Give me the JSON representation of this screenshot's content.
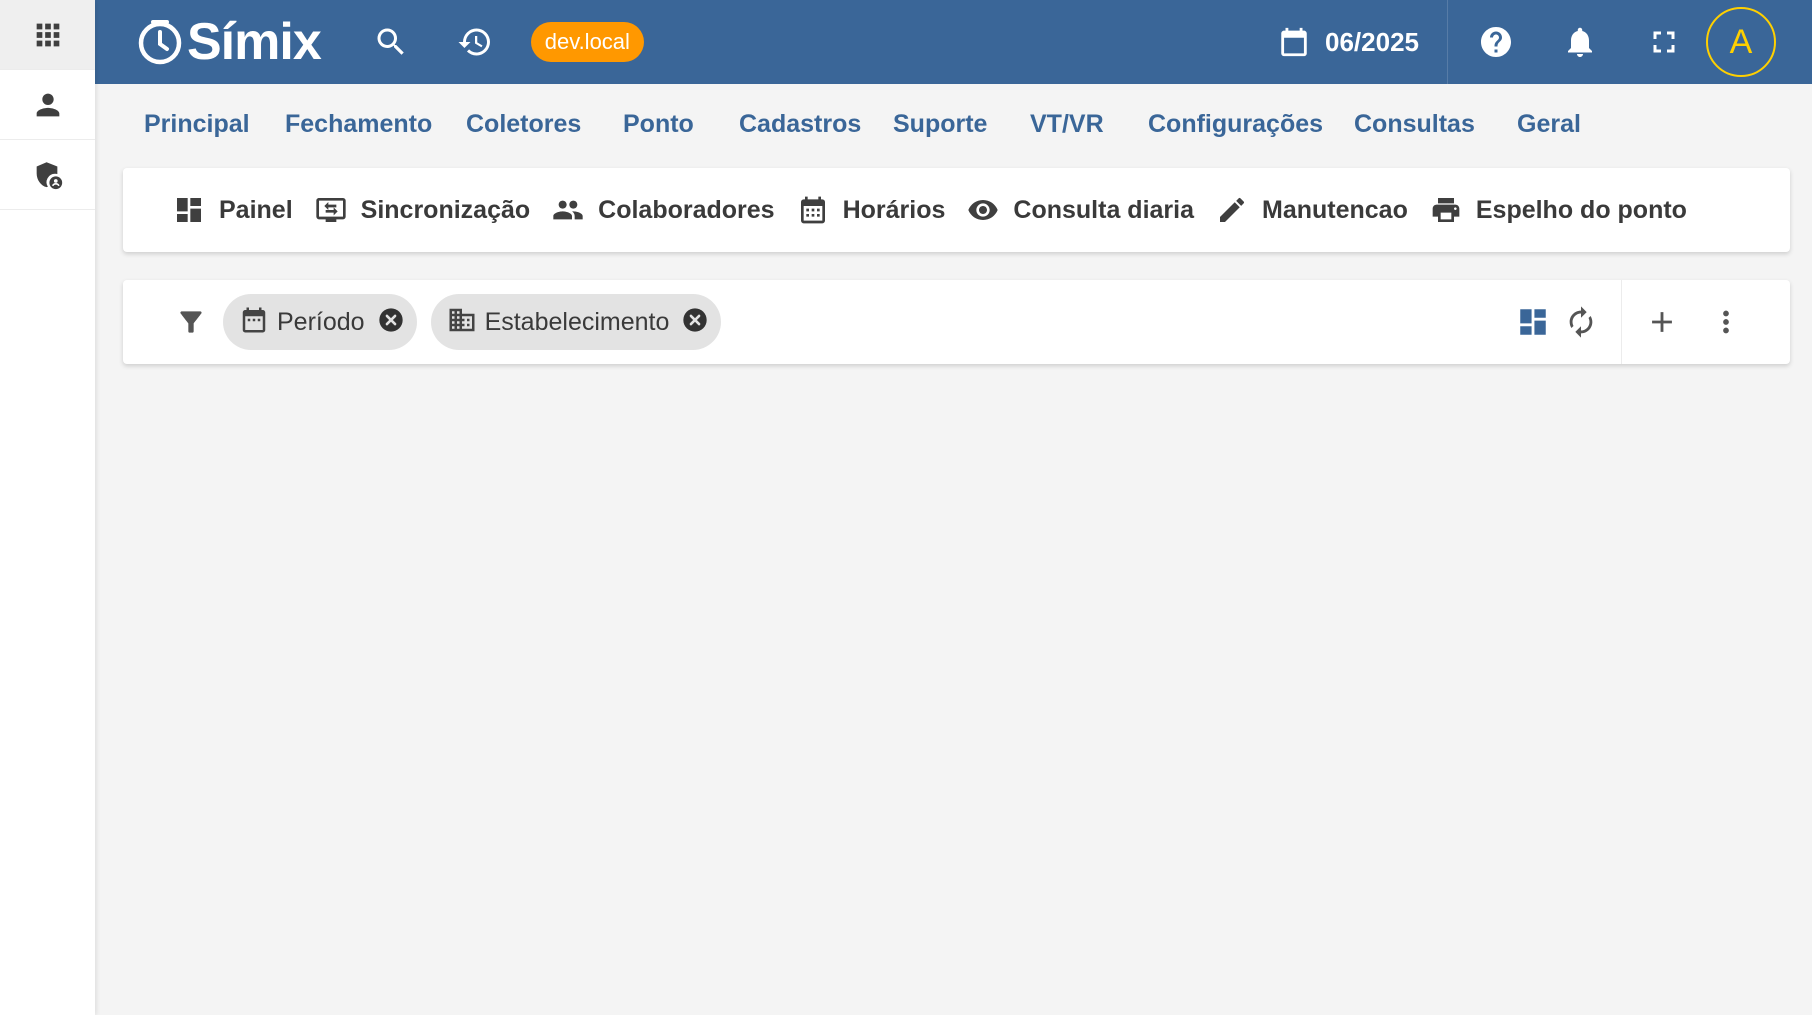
{
  "app": {
    "name": "Símix",
    "environment": "dev.local",
    "period": "06/2025",
    "user_initial": "A"
  },
  "colors": {
    "primary": "#3a6698",
    "badge": "#ff9800",
    "avatar_ring": "#ffd000"
  },
  "rail": {
    "items": [
      {
        "icon": "apps-grid-icon"
      },
      {
        "icon": "person-icon"
      },
      {
        "icon": "admin-shield-icon"
      }
    ]
  },
  "mainmenu": {
    "items": [
      "Principal",
      "Fechamento",
      "Coletores",
      "Ponto",
      "Cadastros",
      "Suporte",
      "VT/VR",
      "Configurações",
      "Consultas",
      "Geral"
    ]
  },
  "submenu": {
    "items": [
      {
        "label": "Painel",
        "icon": "dashboard-icon"
      },
      {
        "label": "Sincronização",
        "icon": "sync-screen-icon"
      },
      {
        "label": "Colaboradores",
        "icon": "people-icon"
      },
      {
        "label": "Horários",
        "icon": "calendar-icon"
      },
      {
        "label": "Consulta diaria",
        "icon": "eye-icon"
      },
      {
        "label": "Manutencao",
        "icon": "pencil-icon"
      },
      {
        "label": "Espelho do ponto",
        "icon": "printer-icon"
      }
    ]
  },
  "filters": {
    "chips": [
      {
        "label": "Período",
        "icon": "calendar-icon"
      },
      {
        "label": "Estabelecimento",
        "icon": "building-icon"
      }
    ]
  }
}
